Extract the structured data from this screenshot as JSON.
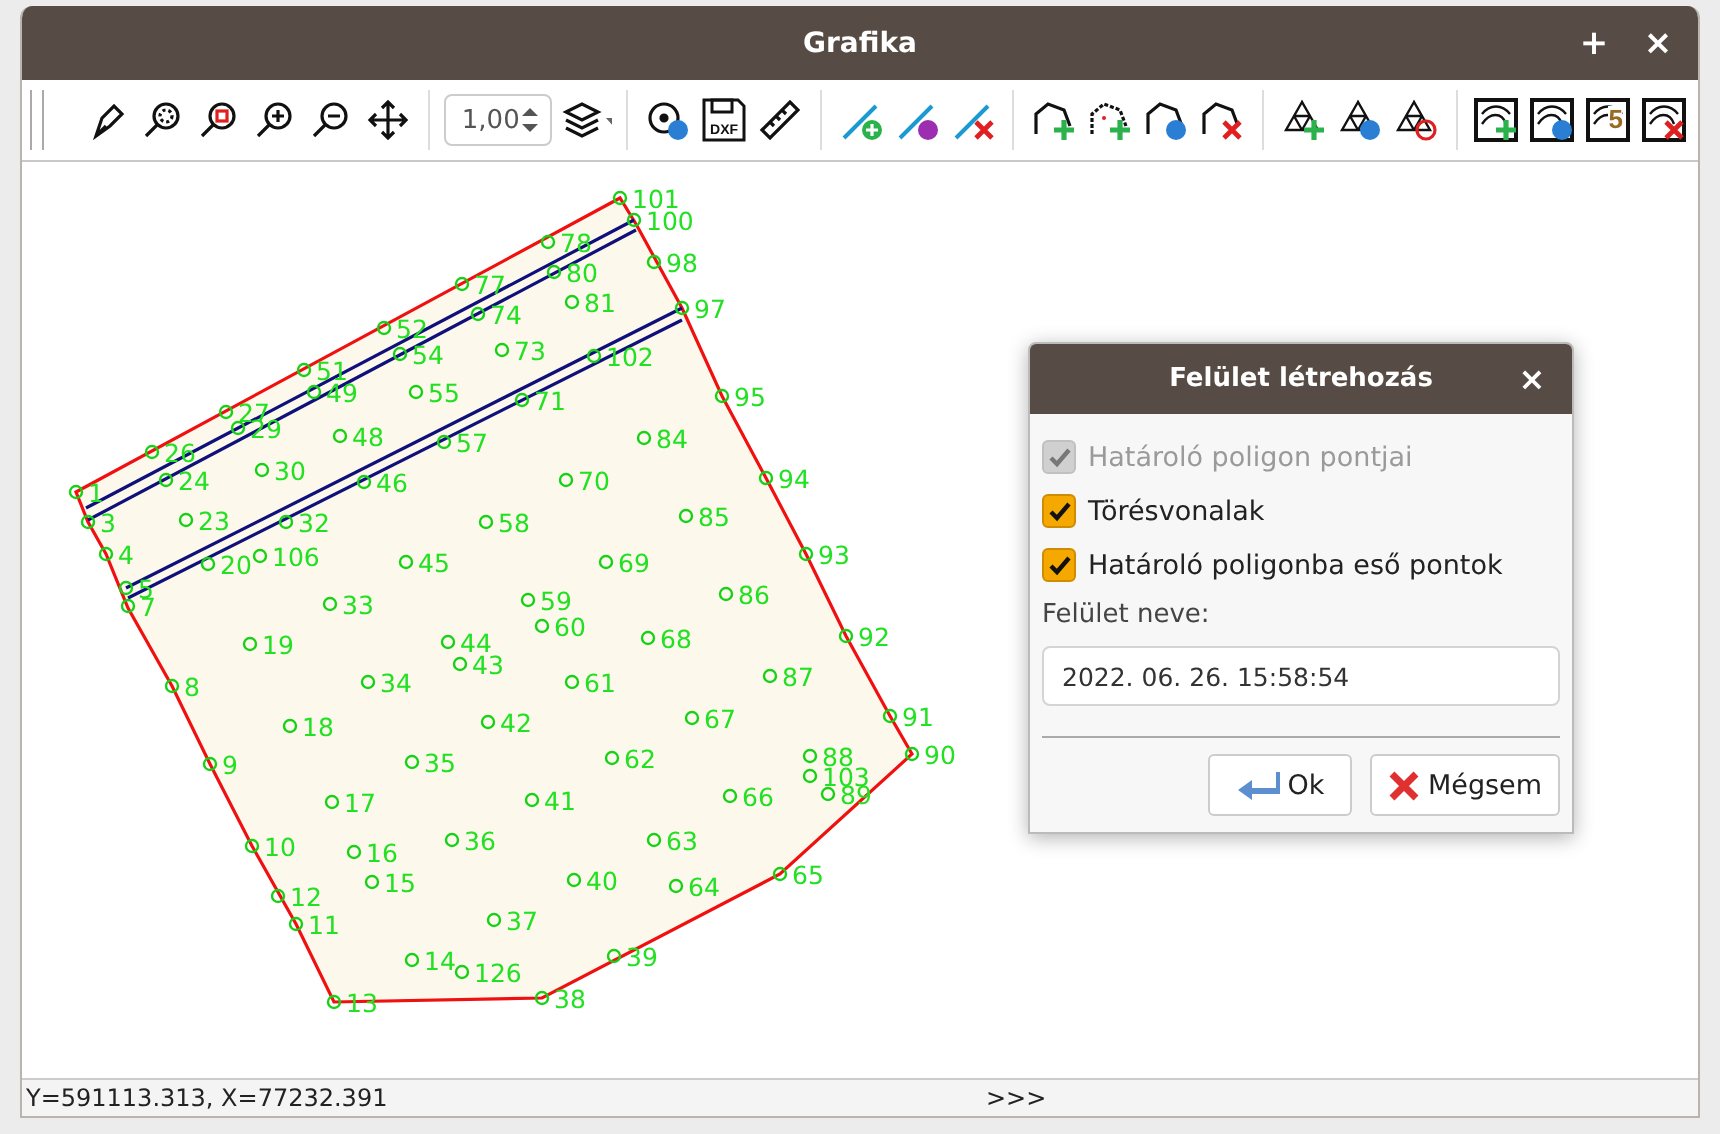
{
  "window": {
    "title": "Grafika",
    "buttons": [
      "+",
      "×"
    ]
  },
  "toolbar": {
    "scale": "1,00",
    "dxf_label": "DXF",
    "surface_number": "5"
  },
  "points": [
    {
      "label": "1"
    },
    {
      "label": "3"
    },
    {
      "label": "4"
    },
    {
      "label": "5"
    },
    {
      "label": "7"
    },
    {
      "label": "8"
    },
    {
      "label": "9"
    },
    {
      "label": "10"
    },
    {
      "label": "12"
    },
    {
      "label": "11"
    },
    {
      "label": "13"
    },
    {
      "label": "14"
    },
    {
      "label": "126"
    },
    {
      "label": "15"
    },
    {
      "label": "16"
    },
    {
      "label": "17"
    },
    {
      "label": "18"
    },
    {
      "label": "19"
    },
    {
      "label": "20"
    },
    {
      "label": "106"
    },
    {
      "label": "23"
    },
    {
      "label": "24"
    },
    {
      "label": "26"
    },
    {
      "label": "27"
    },
    {
      "label": "29"
    },
    {
      "label": "30"
    },
    {
      "label": "32"
    },
    {
      "label": "33"
    },
    {
      "label": "34"
    },
    {
      "label": "35"
    },
    {
      "label": "36"
    },
    {
      "label": "37"
    },
    {
      "label": "38"
    },
    {
      "label": "39"
    },
    {
      "label": "40"
    },
    {
      "label": "41"
    },
    {
      "label": "42"
    },
    {
      "label": "44"
    },
    {
      "label": "43"
    },
    {
      "label": "45"
    },
    {
      "label": "46"
    },
    {
      "label": "48"
    },
    {
      "label": "49"
    },
    {
      "label": "51"
    },
    {
      "label": "52"
    },
    {
      "label": "54"
    },
    {
      "label": "55"
    },
    {
      "label": "57"
    },
    {
      "label": "58"
    },
    {
      "label": "59"
    },
    {
      "label": "60"
    },
    {
      "label": "61"
    },
    {
      "label": "62"
    },
    {
      "label": "63"
    },
    {
      "label": "64"
    },
    {
      "label": "65"
    },
    {
      "label": "66"
    },
    {
      "label": "67"
    },
    {
      "label": "68"
    },
    {
      "label": "69"
    },
    {
      "label": "70"
    },
    {
      "label": "71"
    },
    {
      "label": "73"
    },
    {
      "label": "74"
    },
    {
      "label": "77"
    },
    {
      "label": "78"
    },
    {
      "label": "80"
    },
    {
      "label": "81"
    },
    {
      "label": "84"
    },
    {
      "label": "85"
    },
    {
      "label": "86"
    },
    {
      "label": "87"
    },
    {
      "label": "88"
    },
    {
      "label": "103"
    },
    {
      "label": "89"
    },
    {
      "label": "90"
    },
    {
      "label": "91"
    },
    {
      "label": "92"
    },
    {
      "label": "93"
    },
    {
      "label": "94"
    },
    {
      "label": "95"
    },
    {
      "label": "97"
    },
    {
      "label": "100"
    },
    {
      "label": "98"
    },
    {
      "label": "101"
    },
    {
      "label": "102"
    }
  ],
  "dialog": {
    "title": "Felület létrehozás",
    "close": "×",
    "options": [
      {
        "label": "Határoló poligon pontjai",
        "checked": true,
        "disabled": true
      },
      {
        "label": "Törésvonalak",
        "checked": true,
        "disabled": false
      },
      {
        "label": "Határoló poligonba eső pontok",
        "checked": true,
        "disabled": false
      }
    ],
    "name_label": "Felület neve:",
    "name_value": "2022. 06. 26. 15:58:54",
    "buttons": [
      {
        "kind": "ok",
        "label": "Ok"
      },
      {
        "kind": "cancel",
        "label": "Mégsem"
      }
    ]
  },
  "status_bar": {
    "coordinates": "Y=591113.313, X=77232.391",
    "more": ">>>"
  }
}
